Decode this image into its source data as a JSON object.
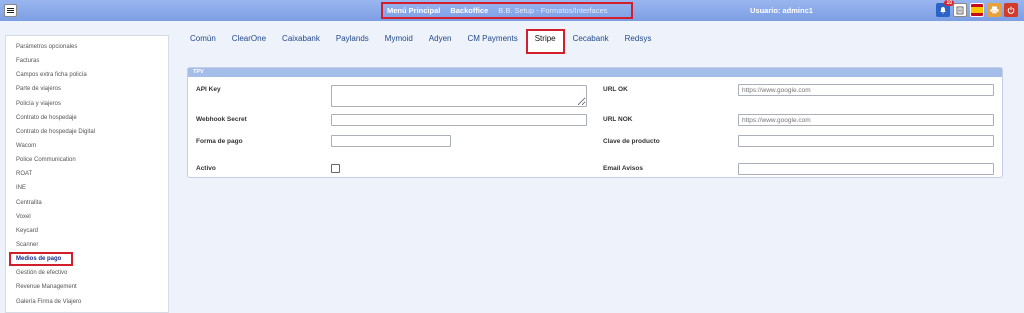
{
  "header": {
    "nav_items": [
      "Menú Principal",
      "Backoffice",
      "B.B. Setup - Formatos/Interfaces"
    ],
    "user_label": "Usuario: adminc1",
    "notifications_count": "10"
  },
  "sidebar": {
    "items": [
      "Parámetros opcionales",
      "Facturas",
      "Campos extra ficha policía",
      "Parte de viajeros",
      "Policía y viajeros",
      "Contrato de hospedaje",
      "Contrato de hospedaje Digital",
      "Wacom",
      "Police Communication",
      "ROAT",
      "INE",
      "Centralita",
      "Voxel",
      "Keycard",
      "Scanner",
      "Medios de pago",
      "Gestión de efectivo",
      "Revenue Management",
      "Galería Firma de Viajero"
    ],
    "active": "Medios de pago"
  },
  "tabs": [
    "Común",
    "ClearOne",
    "Caixabank",
    "Paylands",
    "Mymoid",
    "Adyen",
    "CM Payments",
    "Stripe",
    "Cecabank",
    "Redsys"
  ],
  "active_tab": "Stripe",
  "panel": {
    "title": "TPV",
    "api_key_label": "API Key",
    "api_key_value": "",
    "webhook_label": "Webhook Secret",
    "webhook_value": "",
    "forma_pago_label": "Forma de pago",
    "forma_pago_value": "",
    "activo_label": "Activo",
    "activo_checked": false,
    "url_ok_label": "URL OK",
    "url_ok_placeholder": "https://www.google.com",
    "url_nok_label": "URL NOK",
    "url_nok_placeholder": "https://www.google.com",
    "clave_label": "Clave de producto",
    "clave_value": "",
    "email_label": "Email Avisos",
    "email_value": ""
  }
}
